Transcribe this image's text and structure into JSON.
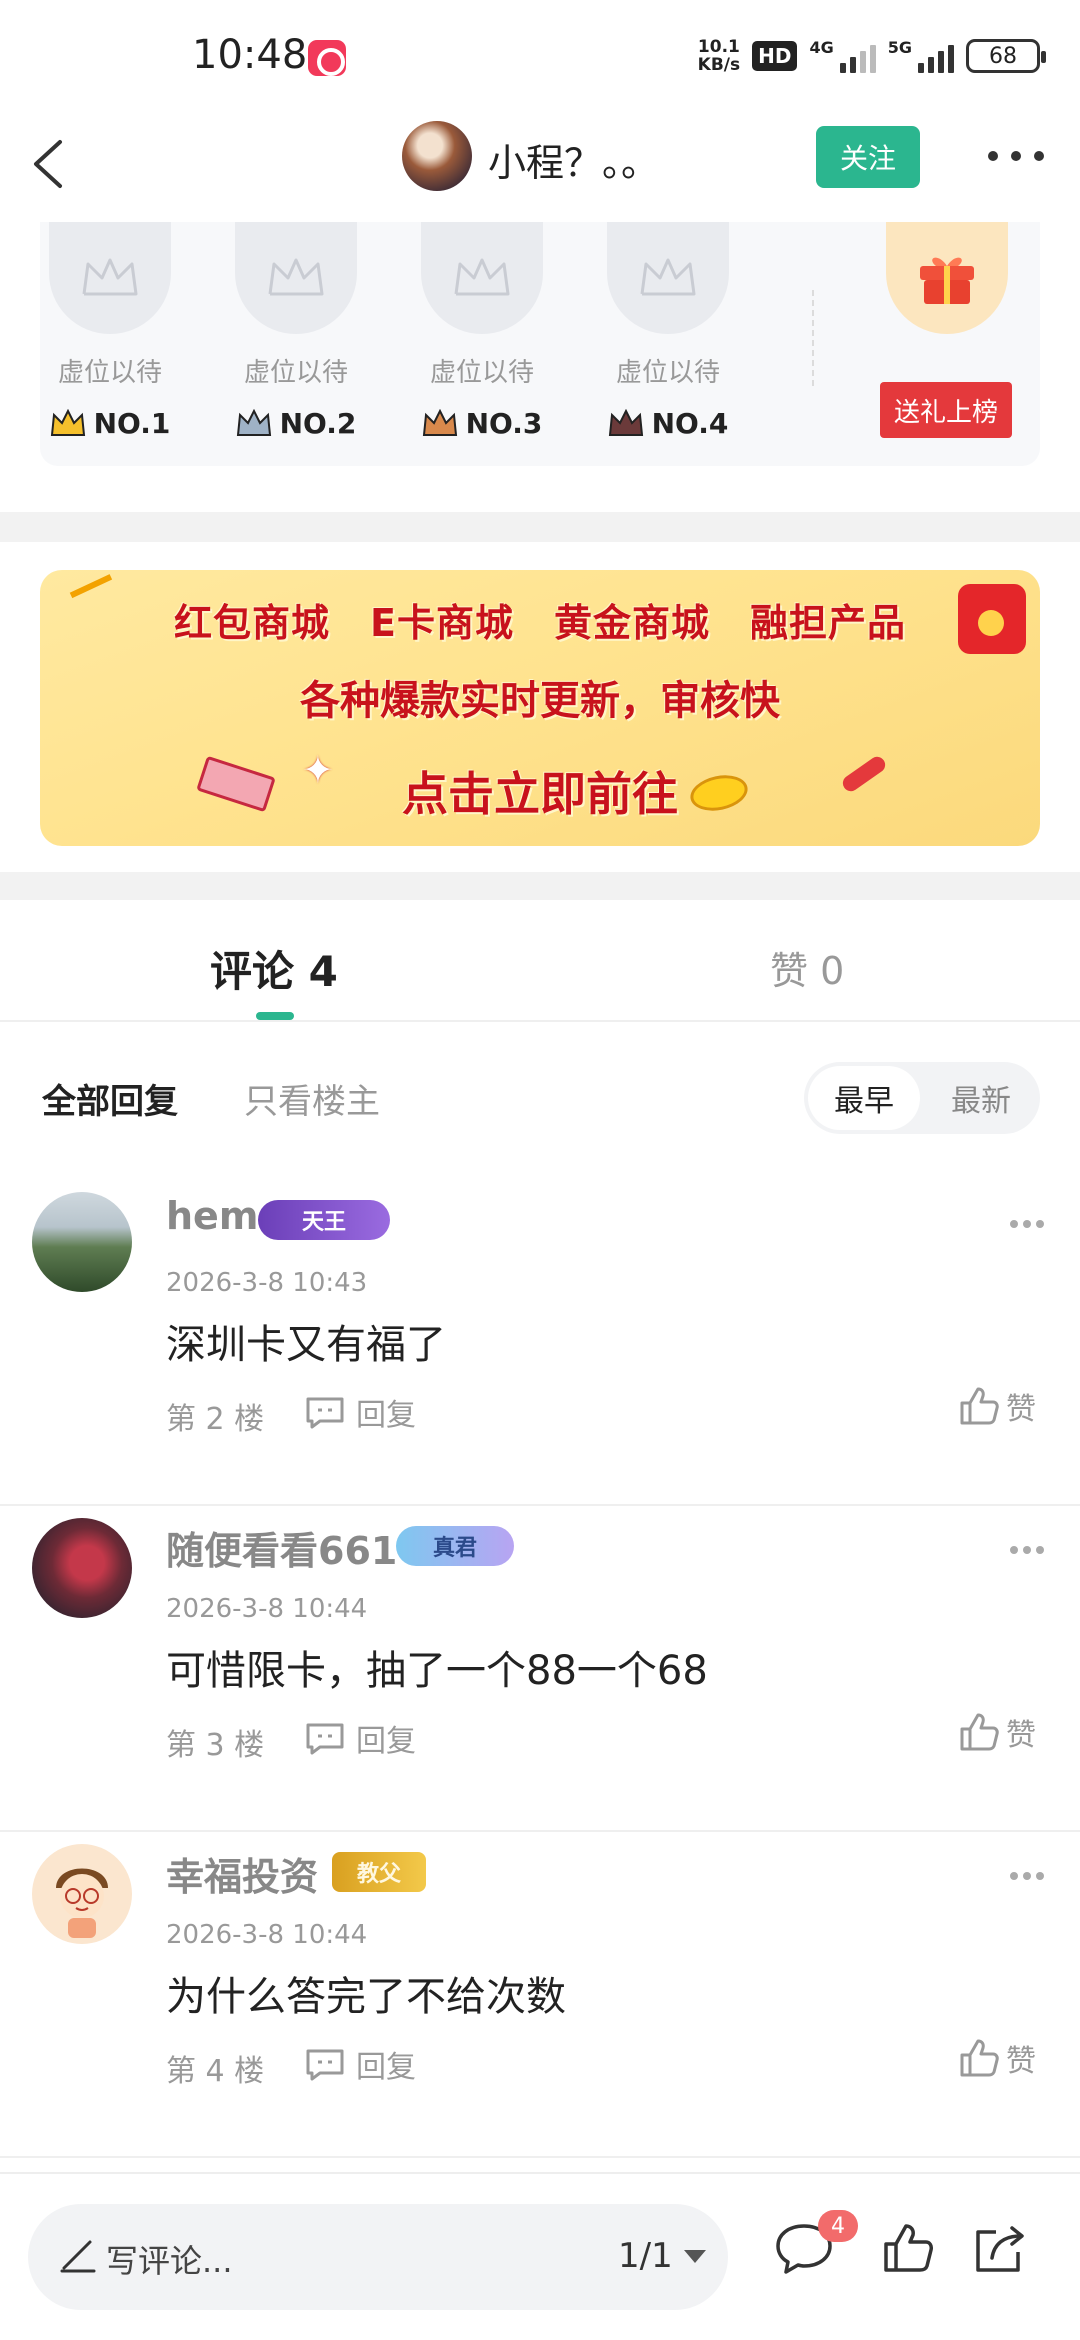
{
  "status_bar": {
    "time": "10:48",
    "net_speed_value": "10.1",
    "net_speed_unit": "KB/s",
    "hd_label": "HD",
    "net_4g": "4G",
    "net_5g": "5G",
    "battery": "68"
  },
  "nav": {
    "title": "小程？。。",
    "follow_label": "关注"
  },
  "ranking": {
    "slots": [
      {
        "label": "虚位以待",
        "rank": "NO.1",
        "crown_color": "#f5c02c"
      },
      {
        "label": "虚位以待",
        "rank": "NO.2",
        "crown_color": "#9fb2c6"
      },
      {
        "label": "虚位以待",
        "rank": "NO.3",
        "crown_color": "#d8894c"
      },
      {
        "label": "虚位以待",
        "rank": "NO.4",
        "crown_color": "#6b3a3a"
      }
    ],
    "gift_button_label": "送礼上榜"
  },
  "banner": {
    "line1": [
      "红包商城",
      "E卡商城",
      "黄金商城",
      "融担产品"
    ],
    "line2": "各种爆款实时更新，审核快",
    "line3": "点击立即前往"
  },
  "tabs": {
    "comments_label": "评论 4",
    "likes_label": "赞 0"
  },
  "filter": {
    "all_label": "全部回复",
    "owner_label": "只看楼主",
    "sort_early": "最早",
    "sort_new": "最新"
  },
  "comments": [
    {
      "name": "hem",
      "badge": "天王",
      "time": "2026-3-8 10:43",
      "text": "深圳卡又有福了",
      "floor": "第 2 楼",
      "reply": "回复",
      "like": "赞"
    },
    {
      "name": "随便看看661",
      "badge": "真君",
      "time": "2026-3-8 10:44",
      "text": "可惜限卡，抽了一个88一个68",
      "floor": "第 3 楼",
      "reply": "回复",
      "like": "赞"
    },
    {
      "name": "幸福投资",
      "badge": "教父",
      "time": "2026-3-8 10:44",
      "text": "为什么答完了不给次数",
      "floor": "第 4 楼",
      "reply": "回复",
      "like": "赞"
    }
  ],
  "bottom": {
    "composer_placeholder": "写评论...",
    "page_indicator": "1/1",
    "comment_count": "4"
  },
  "colors": {
    "accent_green": "#2bb68f",
    "gift_red": "#e4393c",
    "badge_red": "#f26b6b"
  }
}
